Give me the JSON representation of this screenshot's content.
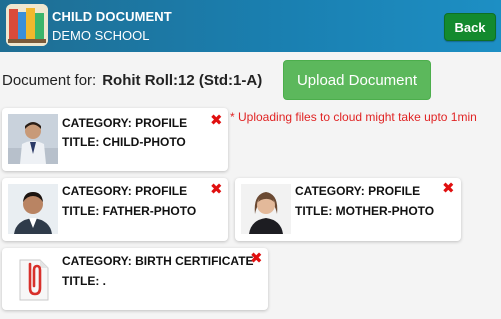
{
  "header": {
    "title": "CHILD DOCUMENT",
    "subtitle": "DEMO SCHOOL",
    "back_label": "Back"
  },
  "document_for": {
    "label": "Document for:",
    "student": "Rohit Roll:12 (Std:1-A)"
  },
  "upload_button": "Upload Document",
  "note": "* Uploading files to cloud might take upto 1min",
  "cards": [
    {
      "category": "CATEGORY: PROFILE",
      "title": "TITLE: CHILD-PHOTO",
      "thumb": "child-photo"
    },
    {
      "category": "CATEGORY: PROFILE",
      "title": "TITLE: FATHER-PHOTO",
      "thumb": "father-photo"
    },
    {
      "category": "CATEGORY: PROFILE",
      "title": "TITLE: MOTHER-PHOTO",
      "thumb": "mother-photo"
    },
    {
      "category": "CATEGORY: BIRTH CERTIFICATE",
      "title": "TITLE: .",
      "thumb": "paperclip-document-icon"
    }
  ],
  "icons": {
    "delete": "close-x-icon"
  },
  "colors": {
    "header": "#1a7fb0",
    "back_button": "#138a2e",
    "upload_button": "#5cb85c",
    "delete": "#e01010",
    "note": "#e02424"
  }
}
